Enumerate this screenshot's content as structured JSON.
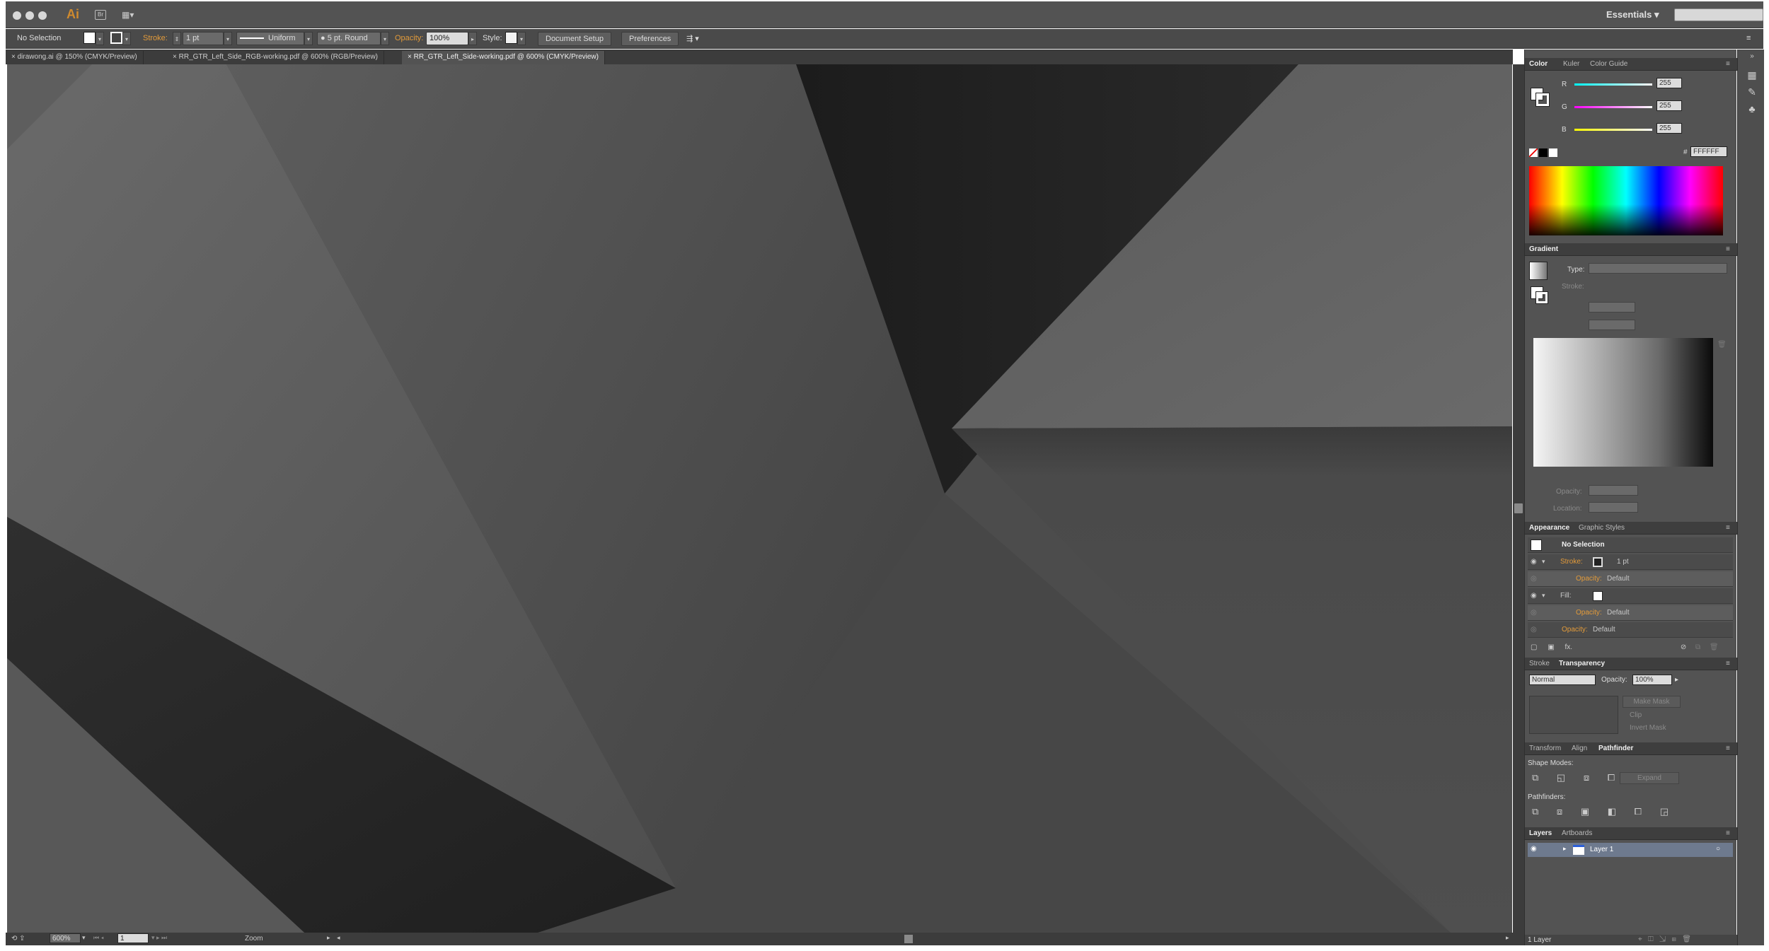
{
  "app": {
    "logo": "Ai",
    "bridge_label": "Br",
    "arrange_icon": "arrange-documents-icon",
    "workspace": "Essentials",
    "search_placeholder": ""
  },
  "control_bar": {
    "selection": "No Selection",
    "stroke_label": "Stroke:",
    "stroke_weight": "1 pt",
    "stroke_profile": "Uniform",
    "brush": "5 pt. Round",
    "opacity_label": "Opacity:",
    "opacity_value": "100%",
    "style_label": "Style:",
    "document_setup": "Document Setup",
    "preferences": "Preferences"
  },
  "tabs": [
    {
      "label": "dirawong.ai @ 150% (CMYK/Preview)"
    },
    {
      "label": "RR_GTR_Left_Side_RGB-working.pdf @ 600% (RGB/Preview)"
    },
    {
      "label": "RR_GTR_Left_Side-working.pdf @ 600% (CMYK/Preview)"
    }
  ],
  "status_bar": {
    "zoom": "600%",
    "artboard": "1",
    "tool": "Zoom"
  },
  "color_panel": {
    "tabs": [
      "Color",
      "Kuler",
      "Color Guide"
    ],
    "r_label": "R",
    "g_label": "G",
    "b_label": "B",
    "r": "255",
    "g": "255",
    "b": "255",
    "hex_label": "#",
    "hex": "FFFFFF"
  },
  "gradient_panel": {
    "title": "Gradient",
    "type_label": "Type:",
    "stroke_label": "Stroke:",
    "opacity_label": "Opacity:",
    "location_label": "Location:"
  },
  "appearance_panel": {
    "tabs": [
      "Appearance",
      "Graphic Styles"
    ],
    "header": "No Selection",
    "stroke_label": "Stroke:",
    "stroke_value": "1 pt",
    "opacity_label": "Opacity:",
    "opacity_default": "Default",
    "fill_label": "Fill:",
    "fx_label": "fx."
  },
  "transparency_panel": {
    "tabs": [
      "Stroke",
      "Transparency"
    ],
    "blend_mode": "Normal",
    "opacity_label": "Opacity:",
    "opacity_value": "100%",
    "make_mask": "Make Mask",
    "clip": "Clip",
    "invert_mask": "Invert Mask"
  },
  "pathfinder_panel": {
    "tabs": [
      "Transform",
      "Align",
      "Pathfinder"
    ],
    "shape_modes": "Shape Modes:",
    "expand": "Expand",
    "pathfinders": "Pathfinders:"
  },
  "layers_panel": {
    "tabs": [
      "Layers",
      "Artboards"
    ],
    "layer_name": "Layer 1",
    "footer": "1 Layer"
  }
}
